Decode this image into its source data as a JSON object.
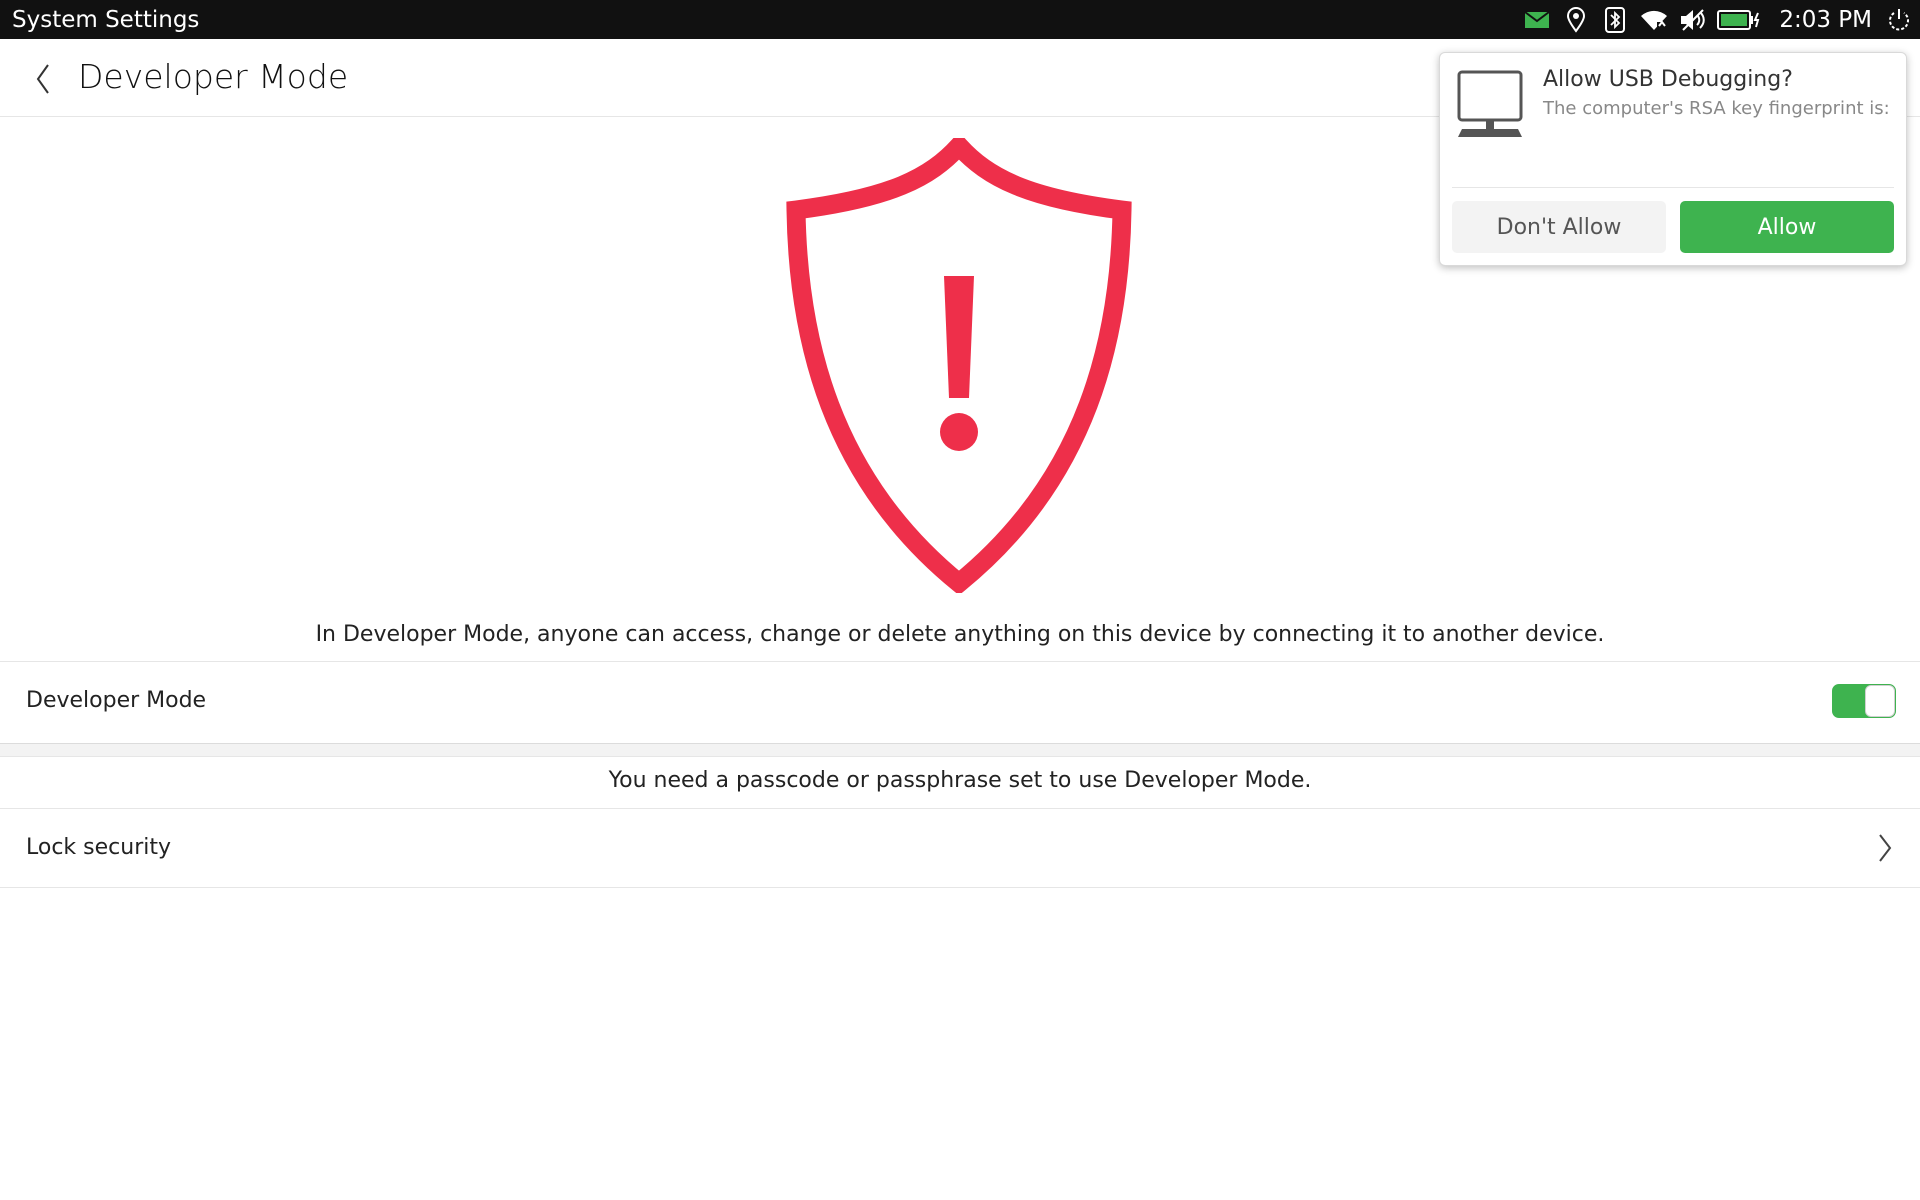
{
  "status_bar": {
    "app_title": "System Settings",
    "time": "2:03 PM",
    "icons": [
      "message-icon",
      "location-icon",
      "bluetooth-icon",
      "wifi-icon",
      "volume-muted-icon",
      "battery-charging-icon",
      "power-icon"
    ]
  },
  "header": {
    "title": "Developer Mode"
  },
  "warning": {
    "text": "In Developer Mode, anyone can access, change or delete anything on this device by connecting it to another device.",
    "icon": "shield-warning-icon",
    "color": "#ee2f4a"
  },
  "developer_mode_row": {
    "label": "Developer Mode",
    "enabled": true
  },
  "passcode_note": "You need a passcode or passphrase set to use Developer Mode.",
  "lock_security_row": {
    "label": "Lock security"
  },
  "dialog": {
    "title": "Allow USB Debugging?",
    "subtitle": "The computer's RSA key fingerprint is:",
    "deny_label": "Don't Allow",
    "allow_label": "Allow"
  },
  "colors": {
    "accent_green": "#3eb34f",
    "status_bar_bg": "#111111"
  }
}
